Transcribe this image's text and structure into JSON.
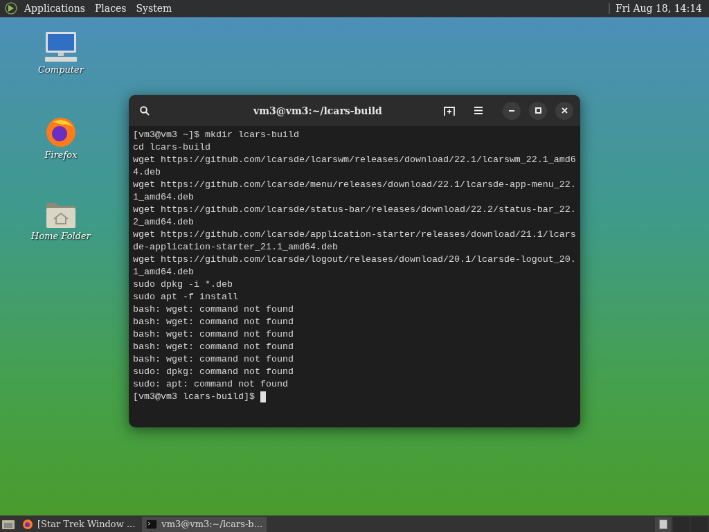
{
  "top_panel": {
    "menus": [
      "Applications",
      "Places",
      "System"
    ],
    "clock": "Fri Aug 18, 14:14"
  },
  "desktop_icons": [
    {
      "kind": "computer",
      "label": "Computer"
    },
    {
      "kind": "browser",
      "label": "Firefox"
    },
    {
      "kind": "home",
      "label": "Home Folder"
    }
  ],
  "terminal": {
    "title": "vm3@vm3:~/lcars-build",
    "lines": [
      "[vm3@vm3 ~]$ mkdir lcars-build",
      "cd lcars-build",
      "wget https://github.com/lcarsde/lcarswm/releases/download/22.1/lcarswm_22.1_amd6",
      "4.deb",
      "wget https://github.com/lcarsde/menu/releases/download/22.1/lcarsde-app-menu_22.",
      "1_amd64.deb",
      "wget https://github.com/lcarsde/status-bar/releases/download/22.2/status-bar_22.",
      "2_amd64.deb",
      "wget https://github.com/lcarsde/application-starter/releases/download/21.1/lcars",
      "de-application-starter_21.1_amd64.deb",
      "wget https://github.com/lcarsde/logout/releases/download/20.1/lcarsde-logout_20.",
      "1_amd64.deb",
      "sudo dpkg -i *.deb",
      "sudo apt -f install",
      "bash: wget: command not found",
      "bash: wget: command not found",
      "bash: wget: command not found",
      "bash: wget: command not found",
      "bash: wget: command not found",
      "sudo: dpkg: command not found",
      "sudo: apt: command not found"
    ],
    "prompt": "[vm3@vm3 lcars-build]$"
  },
  "taskbar": {
    "tasks": [
      {
        "kind": "browser",
        "label": "[Star Trek Window ...",
        "selected": false
      },
      {
        "kind": "terminal",
        "label": "vm3@vm3:~/lcars-b...",
        "selected": true
      }
    ]
  }
}
